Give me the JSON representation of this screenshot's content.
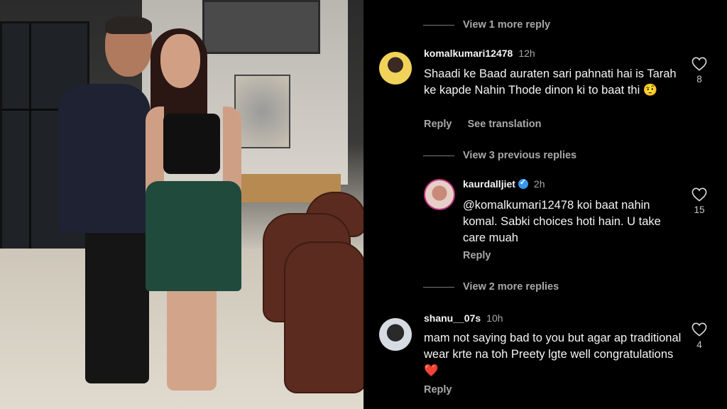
{
  "comments": [
    {
      "id": "view_more_top",
      "type": "view_more",
      "label": "View 1 more reply"
    },
    {
      "id": "c1",
      "username": "komalkumari12478",
      "time": "12h",
      "text": "Shaadi ke Baad auraten sari pahnati hai is Tarah ke kapde Nahin Thode dinon ki to baat thi 🤨",
      "likes": "8",
      "actions": [
        "Reply",
        "See translation"
      ]
    },
    {
      "id": "view_prev",
      "type": "view_more",
      "label": "View 3 previous replies"
    },
    {
      "id": "c2",
      "username": "kaurdalljiet",
      "verified": true,
      "time": "2h",
      "text": "@komalkumari12478 koi baat nahin komal. Sabki choices hoti hain. U take care muah",
      "likes": "15",
      "actions": [
        "Reply"
      ]
    },
    {
      "id": "view_more_2",
      "type": "view_more",
      "label": "View 2 more replies"
    },
    {
      "id": "c3",
      "username": "shanu__07s",
      "time": "10h",
      "text": "mam not saying bad to you but agar ap traditional wear krte na toh Preety lgte well congratulations",
      "heart": "❤️",
      "likes": "4",
      "actions": [
        "Reply"
      ]
    }
  ],
  "icons": {
    "like": "heart-outline-icon",
    "verified": "verified-badge-icon"
  },
  "colors": {
    "background": "#000000",
    "text": "#f5f5f5",
    "muted": "#a8a8a8",
    "verified": "#3897f0"
  }
}
